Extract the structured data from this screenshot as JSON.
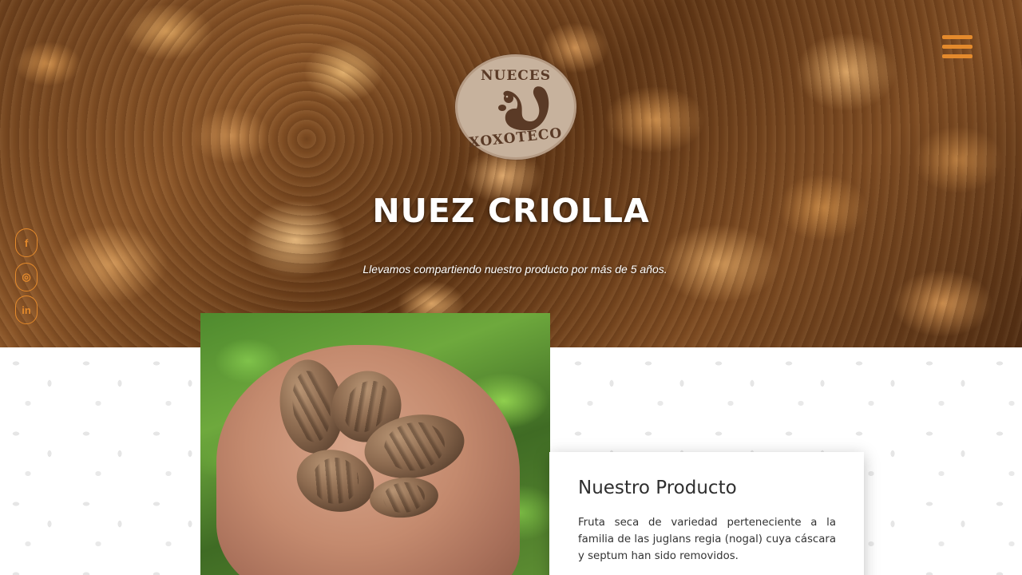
{
  "brand": {
    "logo_top_text": "NUECES",
    "logo_bottom_text": "XOXOTECO"
  },
  "hero": {
    "title": "NUEZ CRIOLLA",
    "subtitle": "Llevamos compartiendo nuestro producto por más de 5 años."
  },
  "social": {
    "facebook_glyph": "f",
    "instagram_glyph": "◎",
    "linkedin_glyph": "in"
  },
  "icons": {
    "menu": "hamburger-menu-icon",
    "facebook": "facebook-icon",
    "instagram": "instagram-icon",
    "linkedin": "linkedin-icon"
  },
  "product": {
    "heading": "Nuestro Producto",
    "description": "Fruta seca de variedad perteneciente a la familia de las juglans regia (nogal) cuya cáscara y septum han sido removidos."
  },
  "colors": {
    "accent": "#e48a2c",
    "logo_bg": "#c7b29d",
    "logo_text": "#5a3a26"
  }
}
